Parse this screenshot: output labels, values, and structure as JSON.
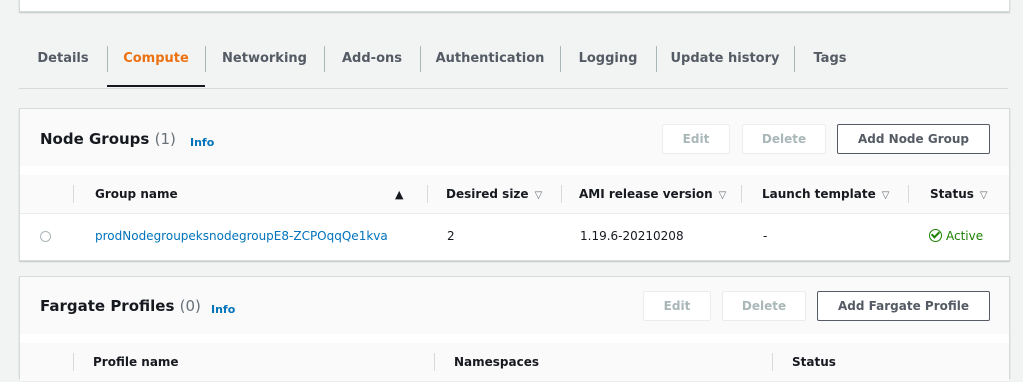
{
  "tabs": [
    {
      "label": "Details"
    },
    {
      "label": "Compute",
      "active": true
    },
    {
      "label": "Networking"
    },
    {
      "label": "Add-ons"
    },
    {
      "label": "Authentication"
    },
    {
      "label": "Logging"
    },
    {
      "label": "Update history"
    },
    {
      "label": "Tags"
    }
  ],
  "node_groups": {
    "title": "Node Groups",
    "count": "(1)",
    "info": "Info",
    "buttons": {
      "edit": "Edit",
      "delete": "Delete",
      "add": "Add Node Group"
    },
    "columns": [
      "Group name",
      "Desired size",
      "AMI release version",
      "Launch template",
      "Status"
    ],
    "sort_indicator": "▲",
    "filter_caret": "▽",
    "rows": [
      {
        "group_name": "prodNodegroupeksnodegroupE8-ZCPOqqQe1kva",
        "desired_size": "2",
        "ami_release_version": "1.19.6-20210208",
        "launch_template": "-",
        "status": "Active"
      }
    ]
  },
  "fargate_profiles": {
    "title": "Fargate Profiles",
    "count": "(0)",
    "info": "Info",
    "buttons": {
      "edit": "Edit",
      "delete": "Delete",
      "add": "Add Fargate Profile"
    },
    "columns": [
      "Profile name",
      "Namespaces",
      "Status"
    ]
  },
  "colors": {
    "accent": "#ec7211",
    "link": "#0073bb",
    "success": "#1d8102"
  }
}
